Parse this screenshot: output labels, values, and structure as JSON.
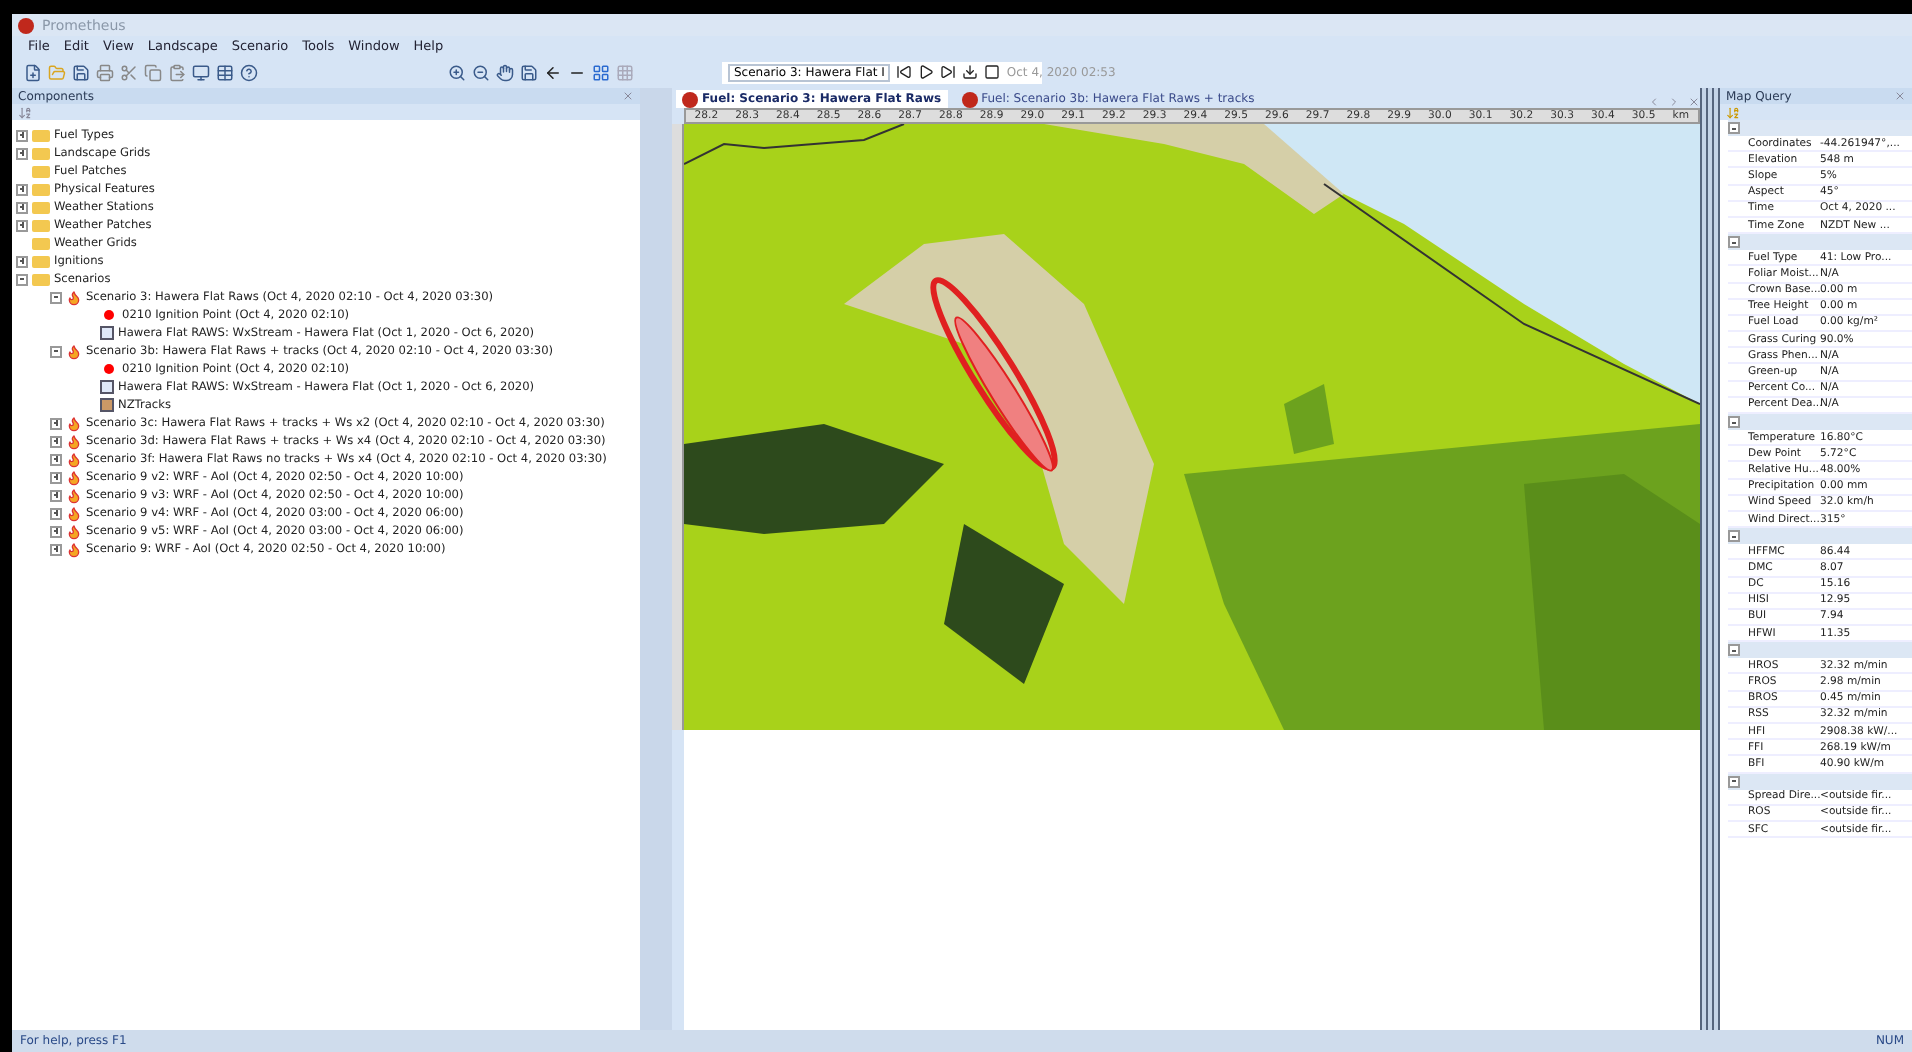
{
  "window": {
    "title": "Prometheus"
  },
  "menu": [
    "File",
    "Edit",
    "View",
    "Landscape",
    "Scenario",
    "Tools",
    "Window",
    "Help"
  ],
  "scenario_toolbar": {
    "scenario": "Scenario 3: Hawera Flat I",
    "time": "Oct  4, 2020 02:53"
  },
  "components": {
    "title": "Components",
    "tree": [
      {
        "label": "Fuel Types",
        "kind": "folder",
        "expanded": false
      },
      {
        "label": "Landscape Grids",
        "kind": "folder",
        "expanded": false
      },
      {
        "label": "Fuel Patches",
        "kind": "folder"
      },
      {
        "label": "Physical Features",
        "kind": "folder",
        "expanded": false
      },
      {
        "label": "Weather Stations",
        "kind": "folder",
        "expanded": false
      },
      {
        "label": "Weather Patches",
        "kind": "folder",
        "expanded": false
      },
      {
        "label": "Weather Grids",
        "kind": "folder"
      },
      {
        "label": "Ignitions",
        "kind": "folder",
        "expanded": false
      },
      {
        "label": "Scenarios",
        "kind": "folder",
        "expanded": true,
        "children": [
          {
            "label": "Scenario 3: Hawera Flat Raws (Oct  4, 2020 02:10 - Oct  4, 2020 03:30)",
            "kind": "scenario",
            "expanded": true,
            "children": [
              {
                "label": "0210 Ignition Point (Oct  4, 2020 02:10)",
                "kind": "ignition"
              },
              {
                "label": "Hawera Flat RAWS: WxStream - Hawera Flat  (Oct  1, 2020 - Oct  6, 2020)",
                "kind": "weather"
              }
            ]
          },
          {
            "label": "Scenario 3b: Hawera Flat Raws + tracks (Oct  4, 2020 02:10 - Oct  4, 2020 03:30)",
            "kind": "scenario",
            "expanded": true,
            "children": [
              {
                "label": "0210 Ignition Point (Oct  4, 2020 02:10)",
                "kind": "ignition"
              },
              {
                "label": "Hawera Flat RAWS: WxStream - Hawera Flat  (Oct  1, 2020 - Oct  6, 2020)",
                "kind": "weather"
              },
              {
                "label": "NZTracks",
                "kind": "tracks"
              }
            ]
          },
          {
            "label": "Scenario 3c: Hawera Flat Raws + tracks + Ws x2 (Oct  4, 2020 02:10 - Oct  4, 2020 03:30)",
            "kind": "scenario",
            "expanded": false
          },
          {
            "label": "Scenario 3d: Hawera Flat Raws + tracks + Ws x4 (Oct  4, 2020 02:10 - Oct  4, 2020 03:30)",
            "kind": "scenario",
            "expanded": false
          },
          {
            "label": "Scenario 3f: Hawera Flat Raws no tracks + Ws x4 (Oct  4, 2020 02:10 - Oct  4, 2020 03:30)",
            "kind": "scenario",
            "expanded": false
          },
          {
            "label": "Scenario 9 v2: WRF - AoI (Oct  4, 2020 02:50 - Oct  4, 2020 10:00)",
            "kind": "scenario",
            "expanded": false
          },
          {
            "label": "Scenario 9 v3: WRF - AoI (Oct  4, 2020 02:50 - Oct  4, 2020 10:00)",
            "kind": "scenario",
            "expanded": false
          },
          {
            "label": "Scenario 9 v4: WRF - AoI (Oct  4, 2020 03:00 - Oct  4, 2020 06:00)",
            "kind": "scenario",
            "expanded": false
          },
          {
            "label": "Scenario 9 v5: WRF - AoI (Oct  4, 2020 03:00 - Oct  4, 2020 06:00)",
            "kind": "scenario",
            "expanded": false
          },
          {
            "label": "Scenario 9: WRF - AoI (Oct  4, 2020 02:50 - Oct  4, 2020 10:00)",
            "kind": "scenario",
            "expanded": false
          }
        ]
      }
    ]
  },
  "map_tabs": [
    {
      "label": "Fuel: Scenario 3: Hawera Flat Raws",
      "selected": true
    },
    {
      "label": "Fuel: Scenario 3b: Hawera Flat Raws + tracks",
      "selected": false
    }
  ],
  "ruler": [
    "28.2",
    "28.3",
    "28.4",
    "28.5",
    "28.6",
    "28.7",
    "28.8",
    "28.9",
    "29.0",
    "29.1",
    "29.2",
    "29.3",
    "29.4",
    "29.5",
    "29.6",
    "29.7",
    "29.8",
    "29.9",
    "30.0",
    "30.1",
    "30.2",
    "30.3",
    "30.4",
    "30.5",
    "km"
  ],
  "map_query": {
    "title": "Map Query",
    "sections": [
      {
        "rows": [
          {
            "label": "Coordinates",
            "value": "-44.261947°,..."
          },
          {
            "label": "Elevation",
            "value": "548 m"
          },
          {
            "label": "Slope",
            "value": "5%"
          },
          {
            "label": "Aspect",
            "value": "45°"
          },
          {
            "label": "Time",
            "value": "Oct  4, 2020 ..."
          },
          {
            "label": "Time Zone",
            "value": "NZDT New ..."
          }
        ]
      },
      {
        "rows": [
          {
            "label": "Fuel Type",
            "value": "41: Low Pro..."
          },
          {
            "label": "Foliar Moist...",
            "value": "N/A"
          },
          {
            "label": "Crown Base...",
            "value": "0.00 m"
          },
          {
            "label": "Tree Height",
            "value": "0.00 m"
          },
          {
            "label": "Fuel Load",
            "value": "0.00 kg/m²"
          },
          {
            "label": "Grass Curing",
            "value": "90.0%"
          },
          {
            "label": "Grass Phen...",
            "value": "N/A"
          },
          {
            "label": "Green-up",
            "value": "N/A"
          },
          {
            "label": "Percent Co...",
            "value": "N/A"
          },
          {
            "label": "Percent Dea...",
            "value": "N/A"
          }
        ]
      },
      {
        "rows": [
          {
            "label": "Temperature",
            "value": "16.80°C"
          },
          {
            "label": "Dew Point",
            "value": "5.72°C"
          },
          {
            "label": "Relative Hu...",
            "value": "48.00%"
          },
          {
            "label": "Precipitation",
            "value": "0.00 mm"
          },
          {
            "label": "Wind Speed",
            "value": "32.0 km/h"
          },
          {
            "label": "Wind Direct...",
            "value": "315°"
          }
        ]
      },
      {
        "rows": [
          {
            "label": "HFFMC",
            "value": "86.44"
          },
          {
            "label": "DMC",
            "value": "8.07"
          },
          {
            "label": "DC",
            "value": "15.16"
          },
          {
            "label": "HISI",
            "value": "12.95"
          },
          {
            "label": "BUI",
            "value": "7.94"
          },
          {
            "label": "HFWI",
            "value": "11.35"
          }
        ]
      },
      {
        "rows": [
          {
            "label": "HROS",
            "value": "32.32 m/min"
          },
          {
            "label": "FROS",
            "value": "2.98 m/min"
          },
          {
            "label": "BROS",
            "value": "0.45 m/min"
          },
          {
            "label": "RSS",
            "value": "32.32 m/min"
          },
          {
            "label": "HFI",
            "value": "2908.38 kW/..."
          },
          {
            "label": "FFI",
            "value": "268.19 kW/m"
          },
          {
            "label": "BFI",
            "value": "40.90 kW/m"
          }
        ]
      },
      {
        "rows": [
          {
            "label": "Spread Dire...",
            "value": "<outside fir..."
          },
          {
            "label": "ROS",
            "value": "<outside fir..."
          },
          {
            "label": "SFC",
            "value": "<outside fir..."
          }
        ]
      }
    ]
  },
  "status_bar": {
    "help": "For help, press F1",
    "indicator": "NUM"
  }
}
